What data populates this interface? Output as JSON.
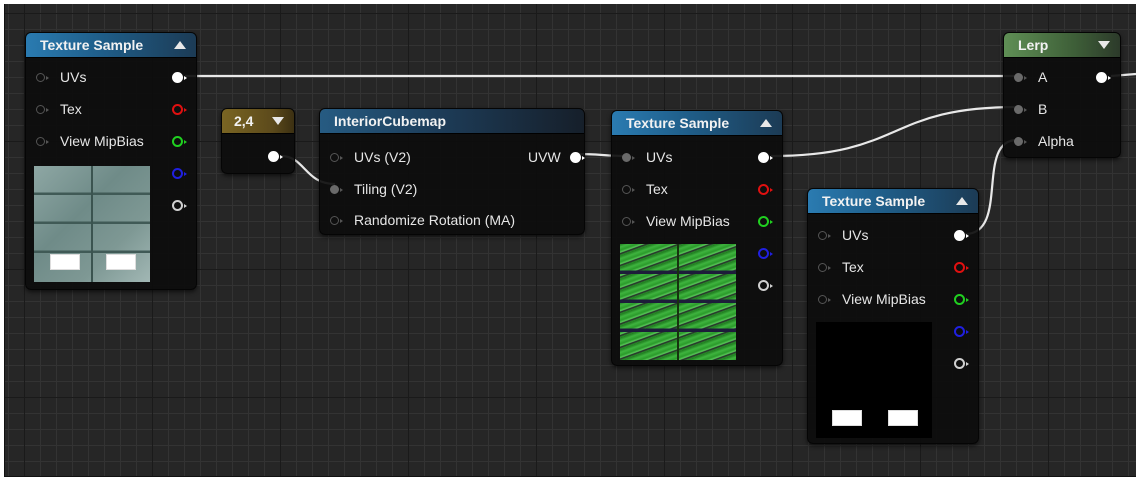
{
  "colors": {
    "background": "#262626",
    "header_blue": "#2a7bb1",
    "header_green": "#5f8f55",
    "header_gold": "#7a6523",
    "pin_red": "#e01010",
    "pin_green": "#20d020",
    "pin_blue": "#2020e0",
    "pin_white": "#ffffff",
    "wire": "#e8e8e8"
  },
  "nodes": {
    "texture_sample_1": {
      "title": "Texture Sample",
      "inputs": [
        "UVs",
        "Tex",
        "View MipBias"
      ],
      "icons": [
        "collapse-arrow-up-icon",
        "rgb-output-pin-icon",
        "red-channel-pin-icon",
        "green-channel-pin-icon",
        "blue-channel-pin-icon",
        "alpha-channel-pin-icon"
      ]
    },
    "constant": {
      "title": "2,4",
      "icons": [
        "collapse-arrow-down-icon",
        "output-pin-icon"
      ]
    },
    "interior_cubemap": {
      "title": "InteriorCubemap",
      "inputs": [
        "UVs (V2)",
        "Tiling (V2)",
        "Randomize Rotation (MA)"
      ],
      "output": "UVW"
    },
    "texture_sample_2": {
      "title": "Texture Sample",
      "inputs": [
        "UVs",
        "Tex",
        "View MipBias"
      ]
    },
    "texture_sample_3": {
      "title": "Texture Sample",
      "inputs": [
        "UVs",
        "Tex",
        "View MipBias"
      ]
    },
    "lerp": {
      "title": "Lerp",
      "inputs": [
        "A",
        "B",
        "Alpha"
      ]
    }
  }
}
